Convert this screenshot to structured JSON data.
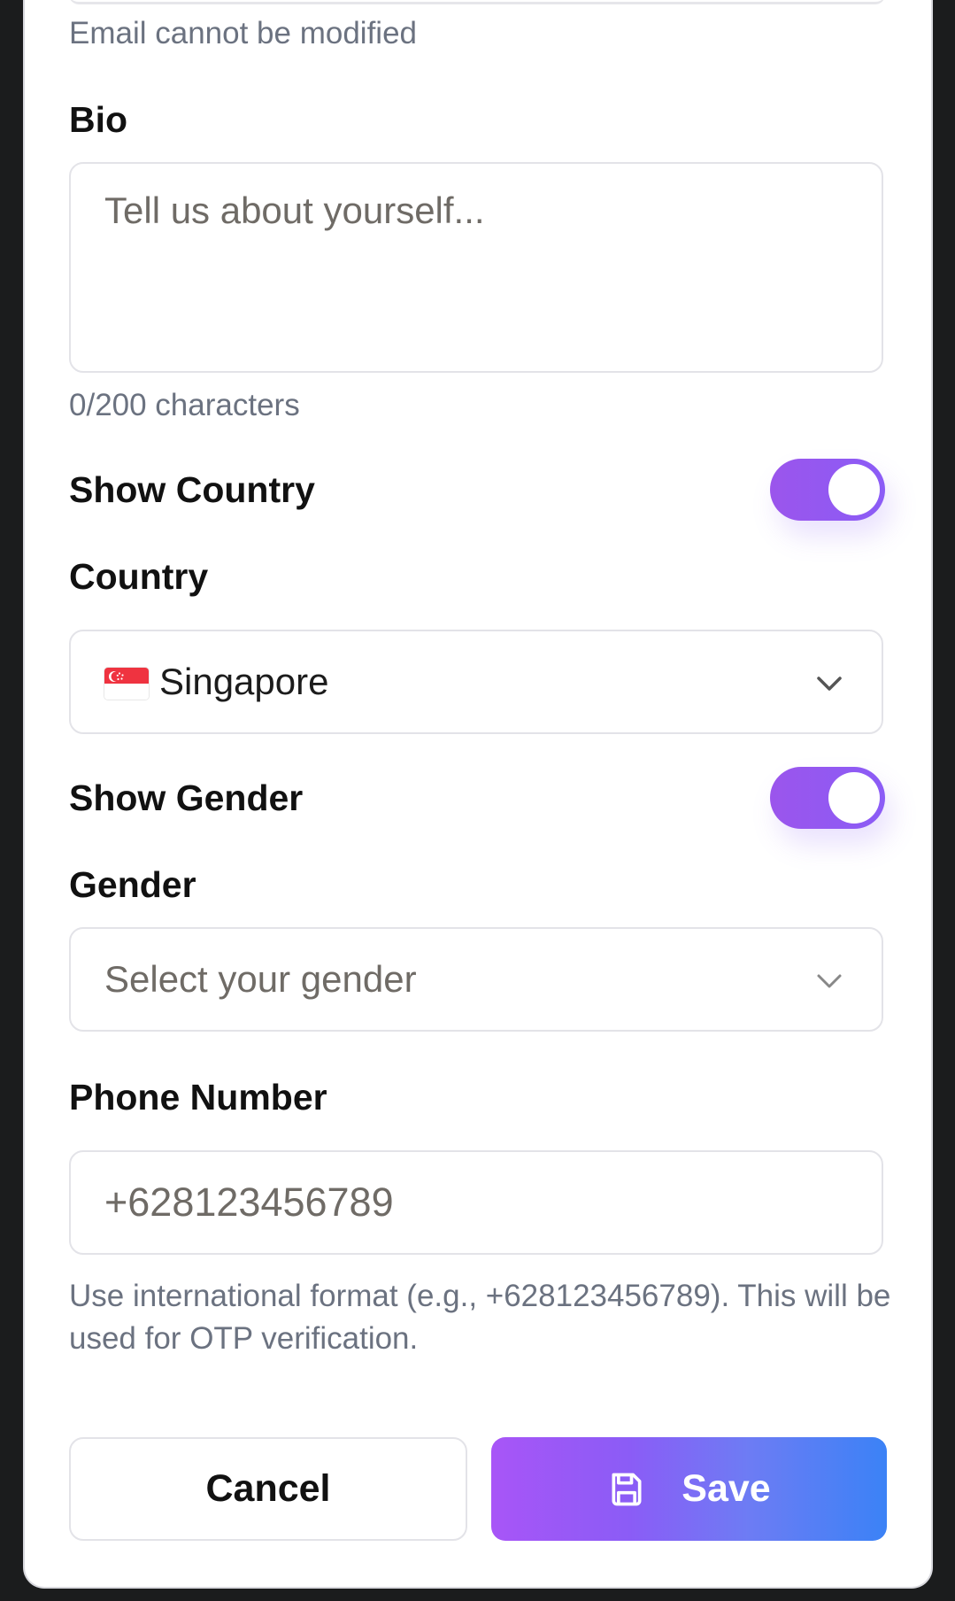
{
  "email": {
    "helper_text": "Email cannot be modified"
  },
  "bio": {
    "label": "Bio",
    "placeholder": "Tell us about yourself...",
    "value": "",
    "char_count": "0/200 characters"
  },
  "show_country": {
    "label": "Show Country",
    "enabled": true
  },
  "country": {
    "label": "Country",
    "selected_value": "Singapore",
    "flag_icon": "singapore-flag-icon"
  },
  "show_gender": {
    "label": "Show Gender",
    "enabled": true
  },
  "gender": {
    "label": "Gender",
    "placeholder": "Select your gender",
    "selected_value": ""
  },
  "phone": {
    "label": "Phone Number",
    "placeholder": "+628123456789",
    "value": "",
    "helper_text": "Use international format (e.g., +628123456789). This will be used for OTP verification."
  },
  "actions": {
    "cancel_label": "Cancel",
    "save_label": "Save",
    "save_icon": "floppy-disk-icon"
  },
  "colors": {
    "toggle_on": "#8b5cf6",
    "save_gradient_start": "#a855f7",
    "save_gradient_end": "#3b82f6",
    "border": "#e3e3e8",
    "helper_text": "#6b7280"
  }
}
